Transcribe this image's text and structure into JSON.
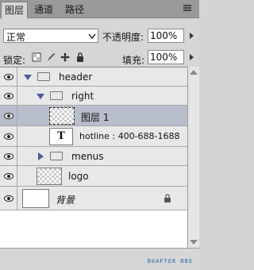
{
  "tabs": [
    "图层",
    "通道",
    "路径"
  ],
  "blend_mode": "正常",
  "opacity_label": "不透明度:",
  "opacity_value": "100%",
  "lock_label": "锁定:",
  "fill_label": "填充:",
  "fill_value": "100%",
  "layers": {
    "header": "header",
    "right": "right",
    "layer1": "图层 1",
    "hotline": "hotline : 400-688-1688",
    "hotline_thumb": "T",
    "menus": "menus",
    "logo": "logo",
    "background": "背景"
  },
  "watermark": "BOAFTER BBS",
  "colors": {
    "selected_row": "#b8bdcc",
    "panel": "#d6d6d6"
  }
}
